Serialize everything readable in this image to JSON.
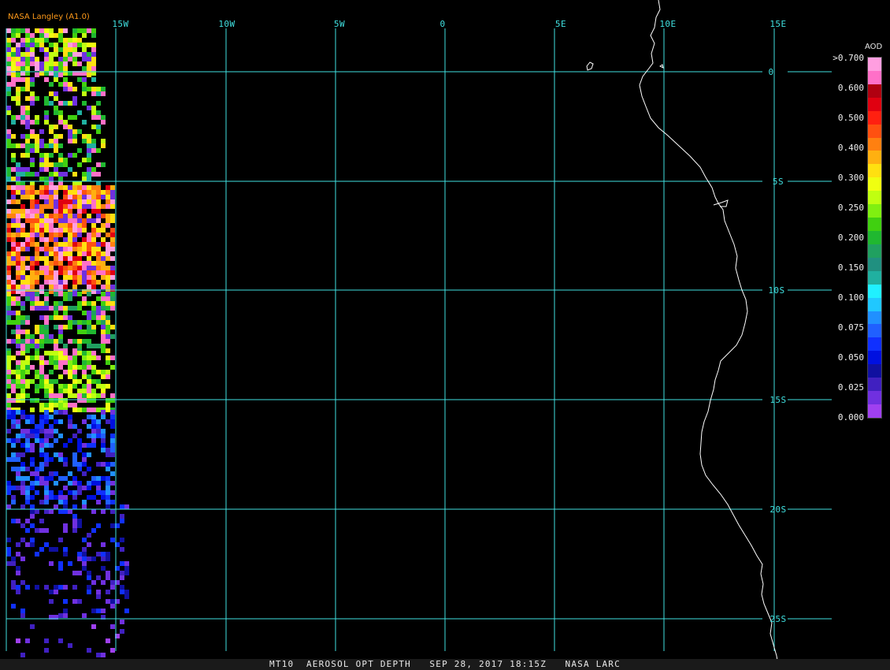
{
  "credit": "NASA Langley (A1.0)",
  "caption": "MT10  AEROSOL OPT DEPTH   SEP 28, 2017 18:15Z   NASA LARC",
  "legend": {
    "title": "AOD",
    "ticks": [
      ">0.700",
      "0.600",
      "0.500",
      "0.400",
      "0.300",
      "0.250",
      "0.200",
      "0.150",
      "0.100",
      "0.075",
      "0.050",
      "0.025",
      "0.000"
    ],
    "colors": [
      "#ff9ee0",
      "#ff70c8",
      "#b00010",
      "#e00010",
      "#ff2010",
      "#ff5010",
      "#ff8010",
      "#ffb010",
      "#ffe010",
      "#f0ff10",
      "#c0ff10",
      "#80f010",
      "#40d010",
      "#20b830",
      "#20a060",
      "#209080",
      "#20b0a0",
      "#20f0ff",
      "#20c8ff",
      "#2090ff",
      "#2060ff",
      "#1030ff",
      "#0010e0",
      "#1010a0",
      "#4020c0",
      "#7030e0",
      "#a040f0"
    ]
  },
  "grid": {
    "longitude_labels": [
      "15W",
      "10W",
      "5W",
      "0",
      "5E",
      "10E",
      "15E"
    ],
    "latitude_labels": [
      "0",
      "5S",
      "10S",
      "15S",
      "20S",
      "25S"
    ]
  },
  "colors": {
    "grid": "#40e0e0",
    "credit": "#ff9a1a",
    "coastline": "#ffffff"
  }
}
